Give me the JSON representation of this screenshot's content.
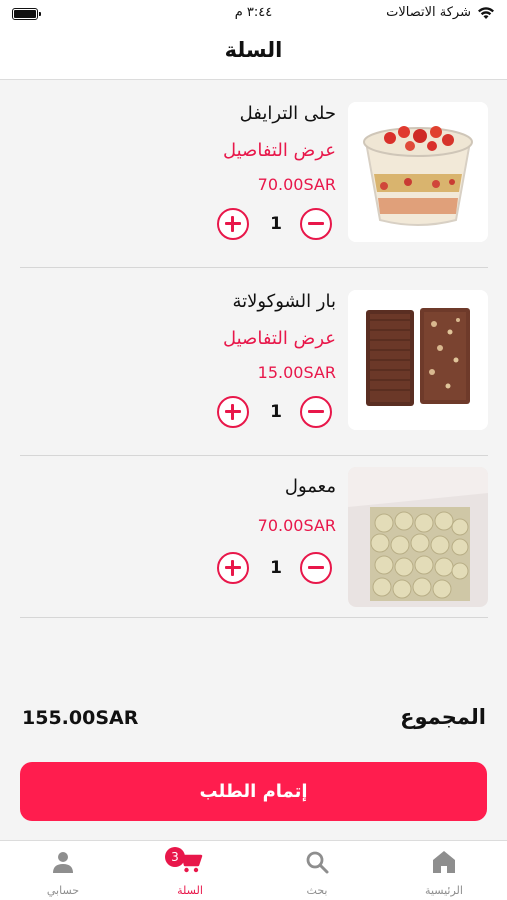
{
  "status_bar": {
    "carrier": "شركة الاتصالات",
    "time": "٣:٤٤ م"
  },
  "header": {
    "title": "السلة"
  },
  "cart": {
    "items": [
      {
        "name": "حلى الترايفل",
        "details_label": "عرض التفاصيل",
        "price": "70.00SAR",
        "quantity": "1",
        "image_icon": "trifle-dessert-image"
      },
      {
        "name": "بار الشوكولاتة",
        "details_label": "عرض التفاصيل",
        "price": "15.00SAR",
        "quantity": "1",
        "image_icon": "chocolate-bar-image"
      },
      {
        "name": "معمول",
        "price": "70.00SAR",
        "quantity": "1",
        "image_icon": "maamoul-box-image"
      }
    ]
  },
  "summary": {
    "total_label": "المجموع",
    "total_value": "155.00SAR"
  },
  "checkout": {
    "label": "إتمام الطلب"
  },
  "tabs": [
    {
      "label": "الرئيسية",
      "icon": "home-icon"
    },
    {
      "label": "بحث",
      "icon": "search-icon"
    },
    {
      "label": "السلة",
      "icon": "cart-icon",
      "badge": "3",
      "active": true
    },
    {
      "label": "حسابي",
      "icon": "person-icon"
    }
  ],
  "colors": {
    "accent": "#e8174a",
    "button": "#ff1d4e",
    "background": "#f4f4f4"
  }
}
